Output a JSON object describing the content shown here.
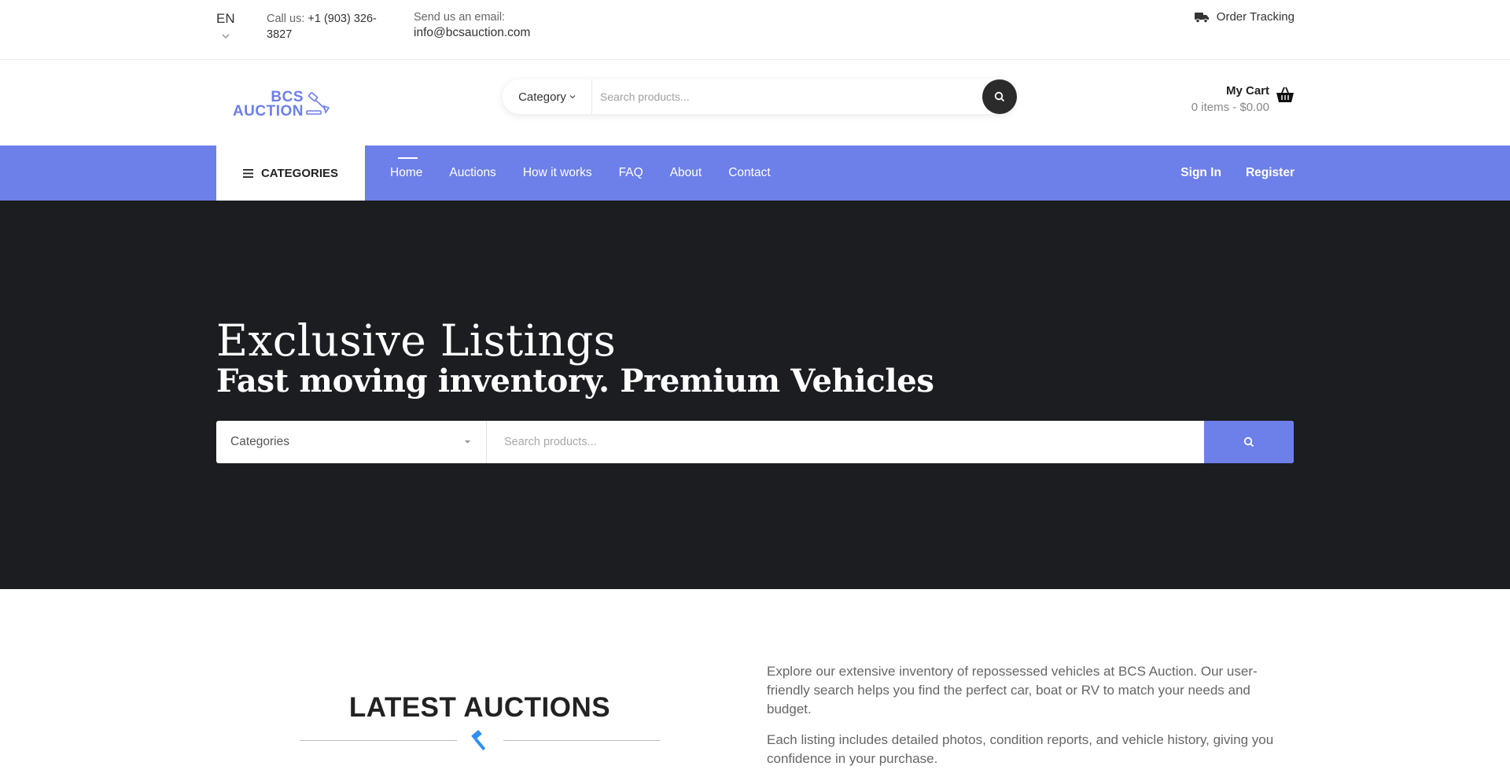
{
  "topbar": {
    "language": "EN",
    "call_label": "Call us:",
    "call_number": "+1 (903) 326-3827",
    "email_label": "Send us an email:",
    "email_value": "info@bcsauction.com",
    "order_tracking": "Order Tracking"
  },
  "header": {
    "logo_text_line1": "BCS",
    "logo_text_line2": "AUCTION",
    "search_category": "Category",
    "search_placeholder": "Search products...",
    "cart_title": "My Cart",
    "cart_summary": "0 items - $0.00"
  },
  "nav": {
    "categories_label": "CATEGORIES",
    "items": [
      "Home",
      "Auctions",
      "How it works",
      "FAQ",
      "About",
      "Contact"
    ],
    "active_item": "Home",
    "sign_in": "Sign In",
    "register": "Register"
  },
  "hero": {
    "title": "Exclusive Listings",
    "subtitle": "Fast moving inventory. Premium Vehicles",
    "categories_select": "Categories",
    "search_placeholder": "Search products..."
  },
  "latest": {
    "title": "LATEST AUCTIONS",
    "paragraph1": "Explore our extensive inventory of repossessed vehicles at BCS Auction. Our user-friendly search helps you find the perfect car, boat or RV to match your needs and budget.",
    "paragraph2": "Each listing includes detailed photos, condition reports, and vehicle history, giving you confidence in your purchase."
  },
  "colors": {
    "accent": "#6d7fe8",
    "hero_bg": "#1b1d21",
    "search_button_dark": "#2b2b2b",
    "gavel_icon": "#2f8ff0"
  },
  "icons": [
    "chevron-down-icon",
    "truck-icon",
    "gavel-logo-icon",
    "search-icon",
    "basket-icon",
    "hamburger-icon",
    "gavel-icon"
  ]
}
